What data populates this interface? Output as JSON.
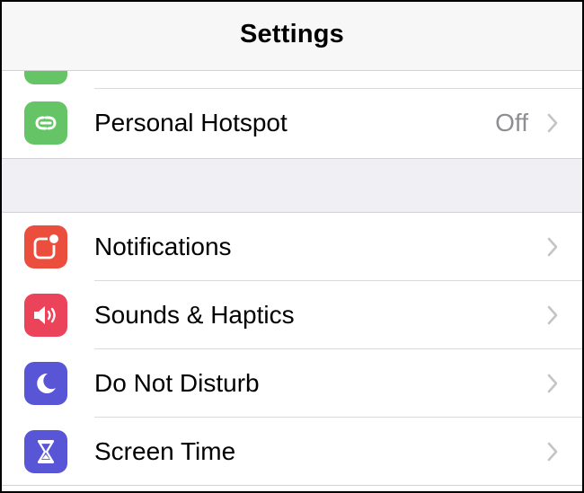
{
  "nav": {
    "title": "Settings"
  },
  "group1": {
    "partial_row_icon_color": "#65c466",
    "rows": [
      {
        "label": "Personal Hotspot",
        "value": "Off",
        "icon": "personal-hotspot-icon",
        "color": "#65c466"
      }
    ]
  },
  "group2": {
    "rows": [
      {
        "label": "Notifications",
        "icon": "notifications-icon",
        "color": "#eb4e3d"
      },
      {
        "label": "Sounds & Haptics",
        "icon": "sounds-haptics-icon",
        "color": "#eb445a"
      },
      {
        "label": "Do Not Disturb",
        "icon": "do-not-disturb-icon",
        "color": "#5856d6"
      },
      {
        "label": "Screen Time",
        "icon": "screen-time-icon",
        "color": "#5856d6"
      }
    ]
  }
}
